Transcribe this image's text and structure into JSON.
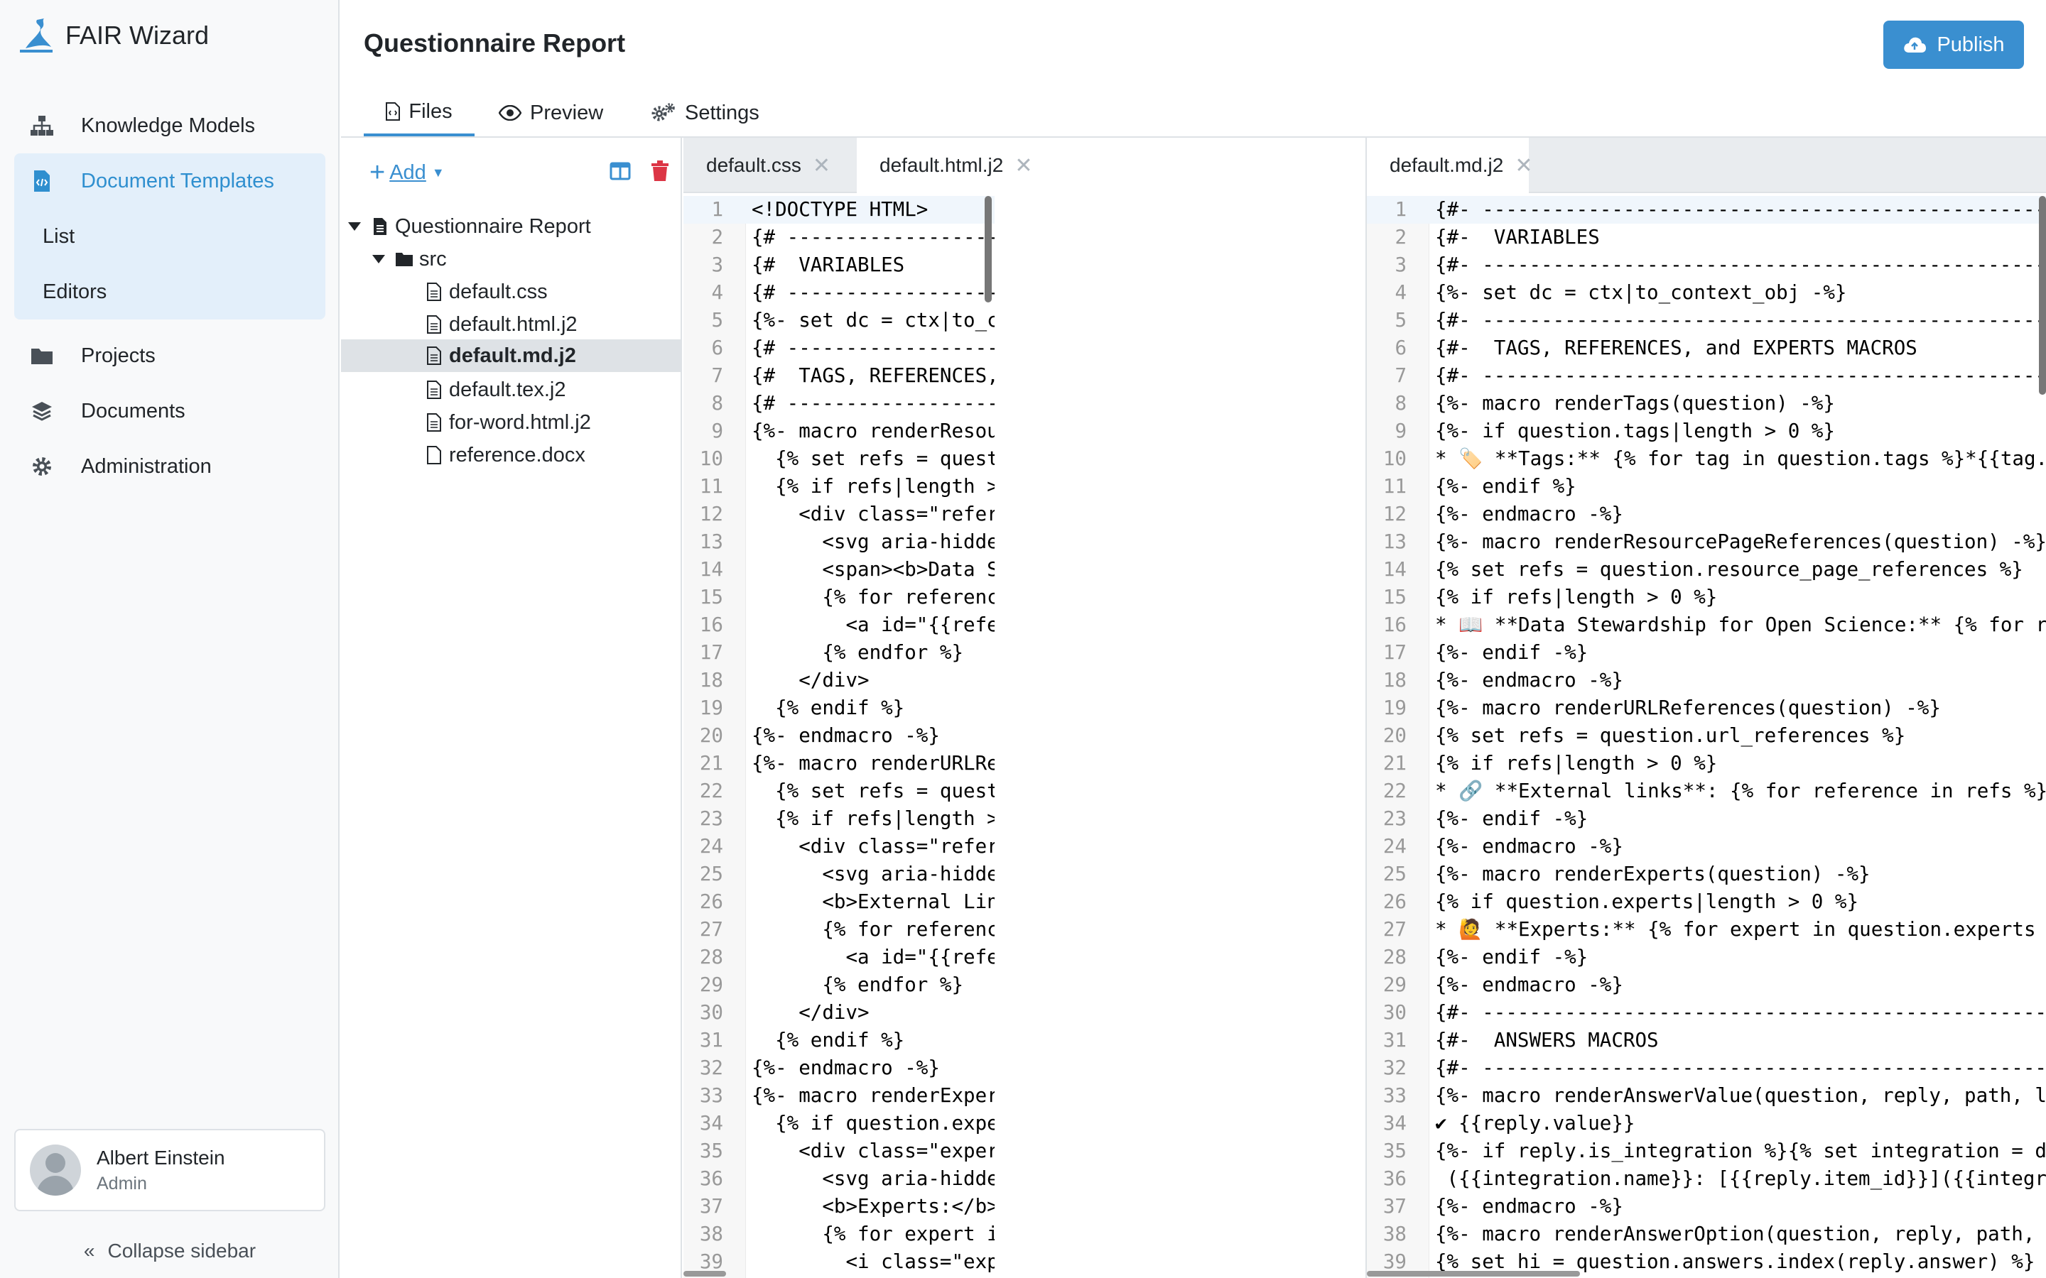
{
  "app": {
    "name": "FAIR Wizard"
  },
  "sidebar": {
    "items": [
      {
        "label": "Knowledge Models",
        "icon": "sitemap-icon"
      },
      {
        "label": "Document Templates",
        "icon": "file-code-icon"
      },
      {
        "label": "Projects",
        "icon": "folder-icon"
      },
      {
        "label": "Documents",
        "icon": "layers-icon"
      },
      {
        "label": "Administration",
        "icon": "gear-icon"
      }
    ],
    "sub_items": [
      {
        "label": "List"
      },
      {
        "label": "Editors"
      }
    ],
    "user": {
      "name": "Albert Einstein",
      "role": "Admin"
    },
    "collapse_label": "Collapse sidebar"
  },
  "header": {
    "title": "Questionnaire Report",
    "publish_label": "Publish",
    "tabs": [
      {
        "label": "Files"
      },
      {
        "label": "Preview"
      },
      {
        "label": "Settings"
      }
    ]
  },
  "tree": {
    "add_label": "Add",
    "root": "Questionnaire Report",
    "folder": "src",
    "files": [
      "default.css",
      "default.html.j2",
      "default.md.j2",
      "default.tex.j2",
      "for-word.html.j2",
      "reference.docx"
    ],
    "selected": "default.md.j2"
  },
  "editor_left": {
    "tabs": [
      "default.css",
      "default.html.j2"
    ],
    "active_tab": "default.html.j2",
    "lines": [
      "<!DOCTYPE HTML>",
      "{# ----------------------------------------------------------------",
      "{#  VARIABLES",
      "{# ----------------------------------------------------------------",
      "{%- set dc = ctx|to_context_obj -%}",
      "{# ----------------------------------------------------------------",
      "{#  TAGS, REFERENCES, and EXPERTS MACROS",
      "{# ----------------------------------------------------------------",
      "{%- macro renderResourcePageReferences(question) -%}",
      "  {% set refs = question.resource_page_references %}",
      "  {% if refs|length > 0 %}",
      "    <div class=\"references references-resourcepage\">",
      "      <svg aria-hidden=\"true\" data-prefix=\"fas\" data-icon",
      "      <span><b>Data Stewardship for Open Science:</b>",
      "      {% for reference in refs %}",
      "        <a id=\"{{reference.uuid}}\" class=\"reference-link\"",
      "      {% endfor %}",
      "    </div>",
      "  {% endif %}",
      "{%- endmacro -%}",
      "{%- macro renderURLReferences(question) -%}",
      "  {% set refs = question.url_references %}",
      "  {% if refs|length > 0 %}",
      "    <div class=\"references references-url\" >",
      "      <svg aria-hidden=\"true\" data-prefix=\"far\" data-icon",
      "      <b>External Links:</b>",
      "      {% for reference in refs %}",
      "        <a id=\"{{reference.uuid}}\" class=\"reference-link\"",
      "      {% endfor %}",
      "    </div>",
      "  {% endif %}",
      "{%- endmacro -%}",
      "{%- macro renderExperts(question) -%}",
      "  {% if question.experts|length > 0 %}",
      "    <div class=\"experts\">",
      "      <svg aria-hidden=\"true\" data-prefix=\"far\" data-icon",
      "      <b>Experts:</b>",
      "      {% for expert in question.experts %}",
      "        <i class=\"expert\">{{expert.name}} (<a href=\"mailto:"
    ]
  },
  "editor_right": {
    "tabs": [
      "default.md.j2"
    ],
    "active_tab": "default.md.j2",
    "lines": [
      "{#- ---------------------------------------------------------",
      "{#-  VARIABLES",
      "{#- ---------------------------------------------------------",
      "{%- set dc = ctx|to_context_obj -%}",
      "{#- ---------------------------------------------------------",
      "{#-  TAGS, REFERENCES, and EXPERTS MACROS",
      "{#- ---------------------------------------------------------",
      "{%- macro renderTags(question) -%}",
      "{%- if question.tags|length > 0 %}",
      "* 🏷️ **Tags:** {% for tag in question.tags %}*{{tag.name}}",
      "{%- endif %}",
      "{%- endmacro -%}",
      "{%- macro renderResourcePageReferences(question) -%}",
      "{% set refs = question.resource_page_references %}",
      "{% if refs|length > 0 %}",
      "* 📖 **Data Stewardship for Open Science:** {% for ref",
      "{%- endif -%}",
      "{%- endmacro -%}",
      "{%- macro renderURLReferences(question) -%}",
      "{% set refs = question.url_references %}",
      "{% if refs|length > 0 %}",
      "* 🔗 **External links**: {% for reference in refs %}",
      "{%- endif -%}",
      "{%- endmacro -%}",
      "{%- macro renderExperts(question) -%}",
      "{% if question.experts|length > 0 %}",
      "* 🙋 **Experts:** {% for expert in question.experts %}",
      "{%- endif -%}",
      "{%- endmacro -%}",
      "{#- ---------------------------------------------------------",
      "{#-  ANSWERS MACROS",
      "{#- ---------------------------------------------------------",
      "{%- macro renderAnswerValue(question, reply, path, level",
      "✔ {{reply.value}}",
      "{%- if reply.is_integration %}{% set integration = dc.kn",
      " ({{integration.name}}: [{{reply.item_id}}]({{integration",
      "{%- endmacro -%}",
      "{%- macro renderAnswerOption(question, reply, path, leve",
      "{% set hi = question.answers.index(reply.answer) %}"
    ]
  }
}
